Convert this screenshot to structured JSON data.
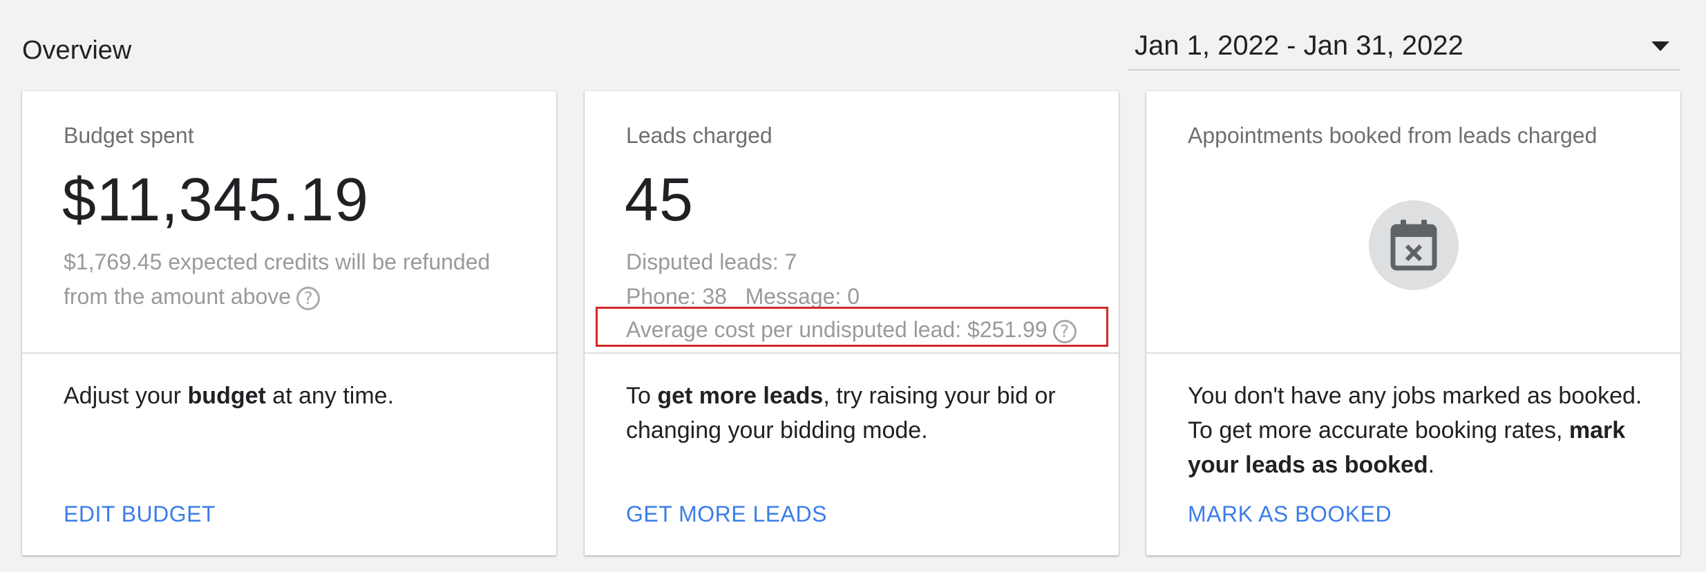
{
  "header": {
    "title": "Overview",
    "date_range": "Jan 1, 2022 - Jan 31, 2022"
  },
  "cards": [
    {
      "label": "Budget spent",
      "value": "$11,345.19",
      "sub_lines": [
        "$1,769.45 expected credits will be refunded",
        "from the amount above"
      ],
      "desc_pre": "Adjust your ",
      "desc_bold": "budget",
      "desc_post": " at any time.",
      "action": "EDIT BUDGET"
    },
    {
      "label": "Leads charged",
      "value": "45",
      "disputed": "Disputed leads: 7",
      "phone": "Phone: 38",
      "message": "Message: 0",
      "avg_cost": "Average cost per undisputed lead: $251.99",
      "desc_pre": "To ",
      "desc_bold": "get more leads",
      "desc_post": ", try raising your bid or changing your bidding mode.",
      "action": "GET MORE LEADS"
    },
    {
      "label": "Appointments booked from leads charged",
      "icon": "calendar-x-icon",
      "desc_pre": "You don't have any jobs marked as booked. To get more accurate booking rates, ",
      "desc_bold": "mark your leads as booked",
      "desc_post": ".",
      "action": "MARK AS BOOKED"
    }
  ],
  "icons": {
    "help": "?"
  },
  "colors": {
    "accent": "#3b7de8",
    "highlight": "#d62828",
    "background": "#f2f2f2"
  }
}
